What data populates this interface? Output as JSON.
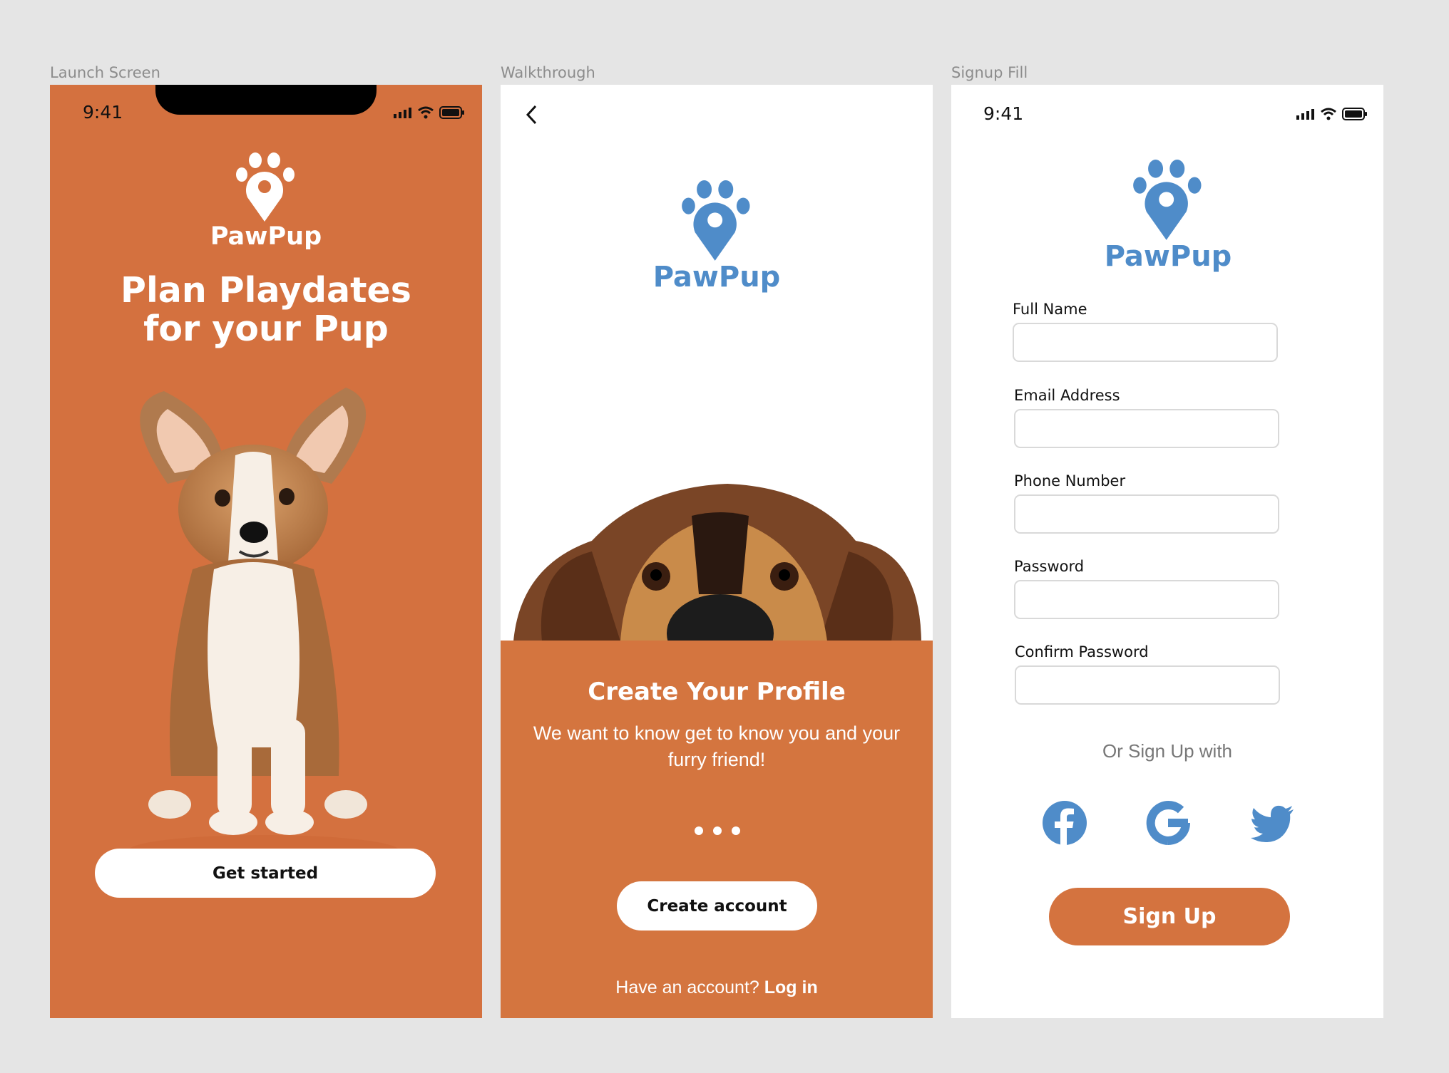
{
  "frames": {
    "launch": {
      "label": "Launch Screen",
      "time": "9:41",
      "logo_text": "PawPup",
      "headline_line1": "Plan Playdates",
      "headline_line2": "for your Pup",
      "cta": "Get started",
      "background_color": "#d4713f"
    },
    "walkthrough": {
      "label": "Walkthrough",
      "logo_text": "PawPup",
      "title": "Create Your Profile",
      "subtitle": "We want to know get to know you and your furry friend!",
      "cta": "Create account",
      "login_prompt": "Have an account?",
      "login_link": "Log in",
      "page_count": 3,
      "panel_color": "#d4753f"
    },
    "signup": {
      "label": "Signup Fill",
      "time": "9:41",
      "logo_text": "PawPup",
      "fields": [
        {
          "label": "Full Name",
          "value": ""
        },
        {
          "label": "Email Address",
          "value": ""
        },
        {
          "label": "Phone Number",
          "value": ""
        },
        {
          "label": "Password",
          "value": ""
        },
        {
          "label": "Confirm Password",
          "value": ""
        }
      ],
      "alt_signup_text": "Or Sign Up with",
      "social": [
        "facebook-icon",
        "google-icon",
        "twitter-icon"
      ],
      "cta": "Sign Up",
      "brand_color": "#4f8cc9",
      "accent_color": "#d4733f"
    }
  }
}
